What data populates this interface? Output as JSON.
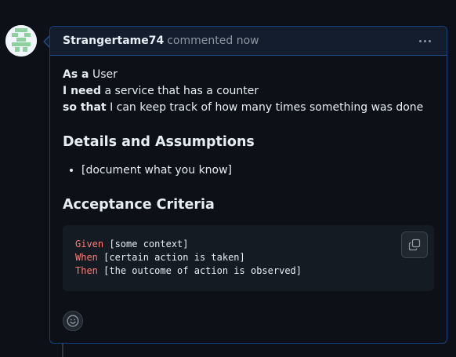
{
  "comment": {
    "author": "Strangertame74",
    "meta": "commented now",
    "menu_icon": "kebab-horizontal-icon"
  },
  "story": {
    "as_a_label": "As a",
    "as_a_value": "User",
    "i_need_label": "I need",
    "i_need_value": "a service that has a counter",
    "so_that_label": "so that",
    "so_that_value": "I can keep track of how many times something was done"
  },
  "details": {
    "heading": "Details and Assumptions",
    "items": [
      "[document what you know]"
    ]
  },
  "acceptance": {
    "heading": "Acceptance Criteria",
    "lines": [
      {
        "keyword": "Given",
        "text": "[some context]"
      },
      {
        "keyword": "When",
        "text": "[certain action is taken]"
      },
      {
        "keyword": "Then",
        "text": "[the outcome of action is observed]"
      }
    ],
    "copy_icon": "copy-icon"
  },
  "reaction_icon": "smiley-icon",
  "colors": {
    "background": "#0d1117",
    "header_bg": "#131d2e",
    "border_accent": "#1f4e8c",
    "code_bg": "#151b23",
    "keyword": "#ff7b72",
    "muted_text": "#8d96a0",
    "text": "#e6edf3"
  }
}
